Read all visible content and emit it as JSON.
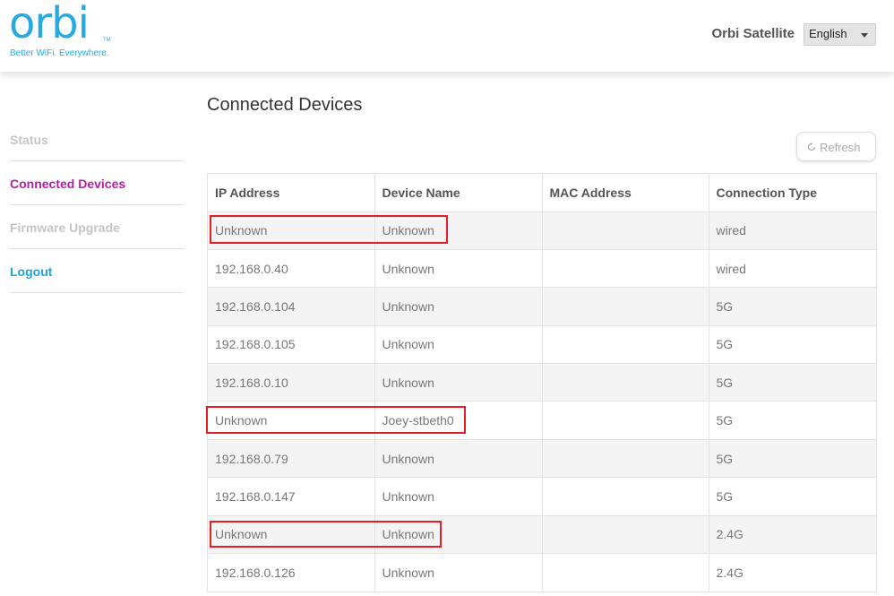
{
  "brand": {
    "logo_text": "orbi",
    "trademark": "TM",
    "tagline": "Better WiFi. Everywhere."
  },
  "header": {
    "device_label": "Orbi Satellite",
    "language": "English"
  },
  "sidebar": {
    "items": [
      {
        "label": "Status",
        "state": "disabled"
      },
      {
        "label": "Connected Devices",
        "state": "active"
      },
      {
        "label": "Firmware Upgrade",
        "state": "disabled"
      },
      {
        "label": "Logout",
        "state": "link"
      }
    ]
  },
  "main": {
    "title": "Connected Devices",
    "refresh_label": "Refresh",
    "table": {
      "columns": [
        "IP Address",
        "Device Name",
        "MAC Address",
        "Connection Type"
      ],
      "rows": [
        {
          "ip": "Unknown",
          "name": "Unknown",
          "mac": "",
          "type": "wired"
        },
        {
          "ip": "192.168.0.40",
          "name": "Unknown",
          "mac": "",
          "type": "wired"
        },
        {
          "ip": "192.168.0.104",
          "name": "Unknown",
          "mac": "",
          "type": "5G"
        },
        {
          "ip": "192.168.0.105",
          "name": "Unknown",
          "mac": "",
          "type": "5G"
        },
        {
          "ip": "192.168.0.10",
          "name": "Unknown",
          "mac": "",
          "type": "5G"
        },
        {
          "ip": "Unknown",
          "name": "Joey-stbeth0",
          "mac": "",
          "type": "5G"
        },
        {
          "ip": "192.168.0.79",
          "name": "Unknown",
          "mac": "",
          "type": "5G"
        },
        {
          "ip": "192.168.0.147",
          "name": "Unknown",
          "mac": "",
          "type": "5G"
        },
        {
          "ip": "Unknown",
          "name": "Unknown",
          "mac": "",
          "type": "2.4G"
        },
        {
          "ip": "192.168.0.126",
          "name": "Unknown",
          "mac": "",
          "type": "2.4G"
        }
      ]
    }
  },
  "colors": {
    "brand_blue": "#27aae1",
    "active_magenta": "#b01fa6",
    "logout_blue": "#1aa4dc",
    "highlight_red": "#e21f27"
  }
}
